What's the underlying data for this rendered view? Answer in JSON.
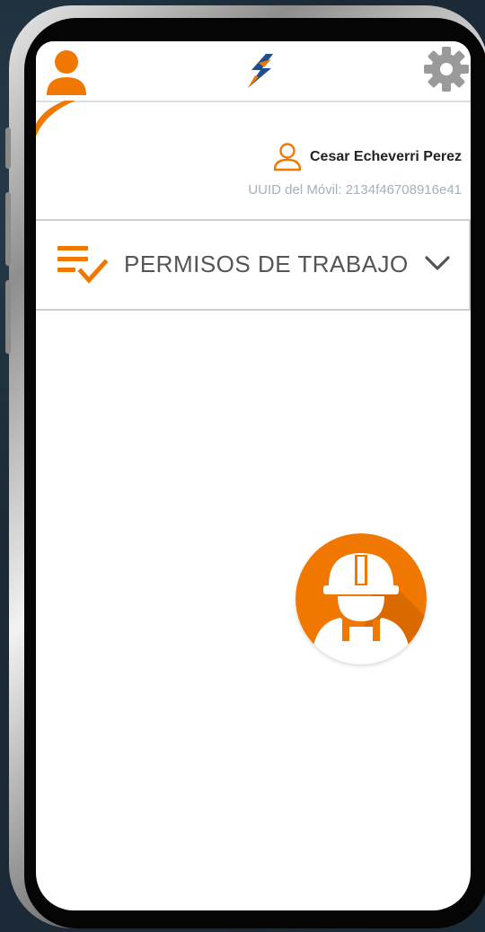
{
  "header": {
    "icons": [
      "user-icon",
      "app-logo-icon",
      "settings-gear-icon"
    ]
  },
  "user": {
    "name": "Cesar Echeverri Perez",
    "uuid_text": "UUID del Móvil: 2134f46708916e41"
  },
  "menu": {
    "section_label": "PERMISOS DE TRABAJO",
    "icon": "checklist-icon",
    "expand_icon": "chevron-down-icon"
  },
  "fab": {
    "icon": "construction-worker-icon"
  },
  "colors": {
    "accent": "#F07800",
    "text_dark": "#222222",
    "text_label": "#555555",
    "text_muted": "#A3B0BD",
    "divider": "#C9CED3",
    "logo_blue": "#1F4E8C"
  }
}
